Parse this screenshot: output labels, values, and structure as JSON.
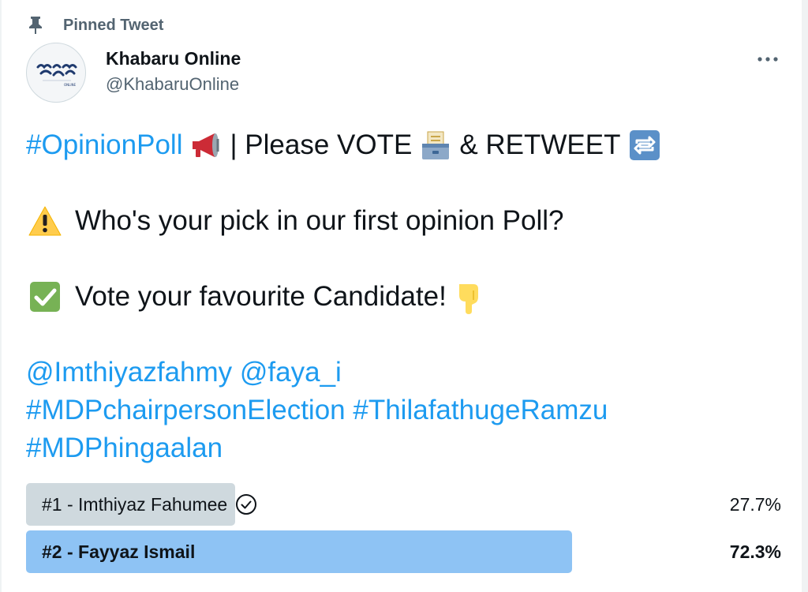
{
  "pinned": {
    "label": "Pinned Tweet",
    "icon": "pin-icon"
  },
  "author": {
    "name": "Khabaru Online",
    "handle": "@KhabaruOnline",
    "avatar_text": "ONLINE"
  },
  "more_icon": "more-icon",
  "tweet": {
    "line1": {
      "hashtag": "#OpinionPoll",
      "text_a": " | Please VOTE ",
      "text_b": " & RETWEET "
    },
    "line2": {
      "text": "Who's your pick in our first opinion Poll?"
    },
    "line3": {
      "text": "Vote your favourite Candidate!"
    },
    "line4": {
      "mention1": "@Imthiyazfahmy",
      "mention2": "@faya_i"
    },
    "line5": {
      "tag1": "#MDPchairpersonElection",
      "tag2": "#ThilafathugeRamzu"
    },
    "line6": {
      "tag1": "#MDPhingaalan"
    },
    "emojis": [
      "megaphone-icon",
      "ballot-box-icon",
      "repeat-icon",
      "warning-icon",
      "check-mark-icon",
      "pointing-down-icon"
    ]
  },
  "poll": {
    "options": [
      {
        "label": "#1 - Imthiyaz Fahumee",
        "percent_label": "27.7%",
        "percent": 27.7,
        "selected": true,
        "bar_color": "#cfd9de"
      },
      {
        "label": "#2 - Fayyaz Ismail",
        "percent_label": "72.3%",
        "percent": 72.3,
        "selected": false,
        "bar_color": "#8ec3f4"
      }
    ]
  },
  "colors": {
    "link": "#1d9bf0",
    "secondary": "#536471",
    "text": "#0f1419"
  }
}
